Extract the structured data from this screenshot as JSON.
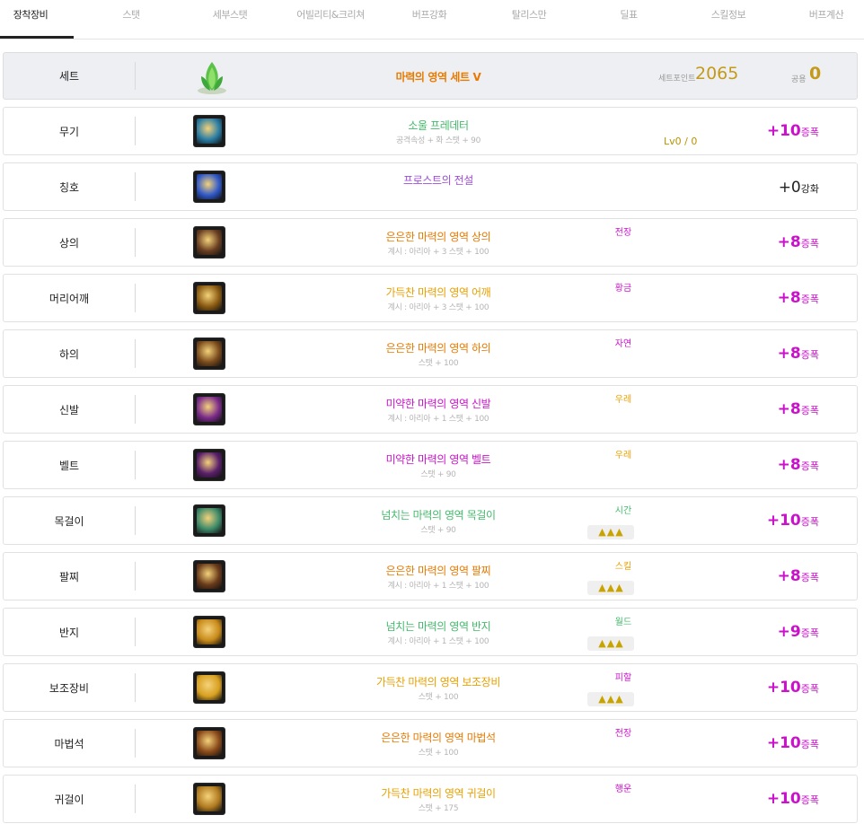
{
  "tabs": [
    "장착장비",
    "스탯",
    "세부스탯",
    "어빌리티&크리쳐",
    "버프강화",
    "탈리스만",
    "딜표",
    "스킬정보",
    "버프계산"
  ],
  "active_tab": "장착장비",
  "set": {
    "slot": "세트",
    "name": "마력의 영역 세트 V",
    "name_color": "#e87a00",
    "point_label": "세트포인트",
    "point_value": "2065",
    "shared_label": "공용",
    "shared_value": "0"
  },
  "items": [
    {
      "slot": "무기",
      "name": "소울 프레데터",
      "name_color": "#43b96b",
      "sub": "공격속성 + 화 스탯 + 90",
      "tag": "",
      "stars": false,
      "lv": "Lv0 / 0",
      "enh_num": "+10",
      "enh_unit": "증폭",
      "enh_plain": false,
      "icon": "weapon-icon",
      "icon_color": "#2a7da5"
    },
    {
      "slot": "칭호",
      "name": "프로스트의 전설",
      "name_color": "#9e4dd8",
      "sub": "",
      "tag": "",
      "stars": false,
      "lv": "",
      "enh_num": "+0",
      "enh_unit": "강화",
      "enh_plain": true,
      "icon": "title-icon",
      "icon_color": "#2f58c9"
    },
    {
      "slot": "상의",
      "name": "은은한 마력의 영역 상의",
      "name_color": "#e87a00",
      "sub": "계시 : 아리아 + 3 스탯 + 100",
      "tag": "전장",
      "tag_color": "#cc11cc",
      "stars": false,
      "lv": "",
      "enh_num": "+8",
      "enh_unit": "증폭",
      "enh_plain": false,
      "icon": "top-armor-icon",
      "icon_color": "#6a3f22"
    },
    {
      "slot": "머리어깨",
      "name": "가득찬 마력의 영역 어깨",
      "name_color": "#e8a000",
      "sub": "계시 : 아리아 + 3 스탯 + 100",
      "tag": "황금",
      "tag_color": "#cc11cc",
      "stars": false,
      "lv": "",
      "enh_num": "+8",
      "enh_unit": "증폭",
      "enh_plain": false,
      "icon": "shoulder-armor-icon",
      "icon_color": "#8a5a12"
    },
    {
      "slot": "하의",
      "name": "은은한 마력의 영역 하의",
      "name_color": "#e87a00",
      "sub": "스탯 + 100",
      "tag": "자연",
      "tag_color": "#cc11cc",
      "stars": false,
      "lv": "",
      "enh_num": "+8",
      "enh_unit": "증폭",
      "enh_plain": false,
      "icon": "pants-armor-icon",
      "icon_color": "#7a4a1c"
    },
    {
      "slot": "신발",
      "name": "미약한 마력의 영역 신발",
      "name_color": "#cc11cc",
      "sub": "계시 : 아리아 + 1 스탯 + 100",
      "tag": "우레",
      "tag_color": "#e8a000",
      "stars": false,
      "lv": "",
      "enh_num": "+8",
      "enh_unit": "증폭",
      "enh_plain": false,
      "icon": "shoes-armor-icon",
      "icon_color": "#7a2a8a"
    },
    {
      "slot": "벨트",
      "name": "미약한 마력의 영역 벨트",
      "name_color": "#cc11cc",
      "sub": "스탯 + 90",
      "tag": "우레",
      "tag_color": "#e8a000",
      "stars": false,
      "lv": "",
      "enh_num": "+8",
      "enh_unit": "증폭",
      "enh_plain": false,
      "icon": "belt-armor-icon",
      "icon_color": "#5a1f6a"
    },
    {
      "slot": "목걸이",
      "name": "넘치는 마력의 영역 목걸이",
      "name_color": "#43b96b",
      "sub": "스탯 + 90",
      "tag": "시간",
      "tag_color": "#43b96b",
      "stars": true,
      "lv": "",
      "enh_num": "+10",
      "enh_unit": "증폭",
      "enh_plain": false,
      "icon": "necklace-icon",
      "icon_color": "#3d8a6a"
    },
    {
      "slot": "팔찌",
      "name": "은은한 마력의 영역 팔찌",
      "name_color": "#e87a00",
      "sub": "계시 : 아리아 + 1 스탯 + 100",
      "tag": "스킬",
      "tag_color": "#e8a000",
      "stars": true,
      "lv": "",
      "enh_num": "+8",
      "enh_unit": "증폭",
      "enh_plain": false,
      "icon": "bracelet-icon",
      "icon_color": "#6a3a1a"
    },
    {
      "slot": "반지",
      "name": "넘치는 마력의 영역 반지",
      "name_color": "#43b96b",
      "sub": "계시 : 아리아 + 1 스탯 + 100",
      "tag": "월드",
      "tag_color": "#43b96b",
      "stars": true,
      "lv": "",
      "enh_num": "+9",
      "enh_unit": "증폭",
      "enh_plain": false,
      "icon": "ring-icon",
      "icon_color": "#c88a1a"
    },
    {
      "slot": "보조장비",
      "name": "가득찬 마력의 영역 보조장비",
      "name_color": "#e8a000",
      "sub": "스탯 + 100",
      "tag": "피할",
      "tag_color": "#cc11cc",
      "stars": true,
      "lv": "",
      "enh_num": "+10",
      "enh_unit": "증폭",
      "enh_plain": false,
      "icon": "support-equip-icon",
      "icon_color": "#d8a020"
    },
    {
      "slot": "마법석",
      "name": "은은한 마력의 영역 마법석",
      "name_color": "#e87a00",
      "sub": "스탯 + 100",
      "tag": "전장",
      "tag_color": "#cc11cc",
      "stars": false,
      "lv": "",
      "enh_num": "+10",
      "enh_unit": "증폭",
      "enh_plain": false,
      "icon": "magic-stone-icon",
      "icon_color": "#8a4a1a"
    },
    {
      "slot": "귀걸이",
      "name": "가득찬 마력의 영역 귀걸이",
      "name_color": "#e8a000",
      "sub": "스탯 + 175",
      "tag": "행운",
      "tag_color": "#cc11cc",
      "stars": false,
      "lv": "",
      "enh_num": "+10",
      "enh_unit": "증폭",
      "enh_plain": false,
      "icon": "earring-icon",
      "icon_color": "#b07a20"
    }
  ]
}
